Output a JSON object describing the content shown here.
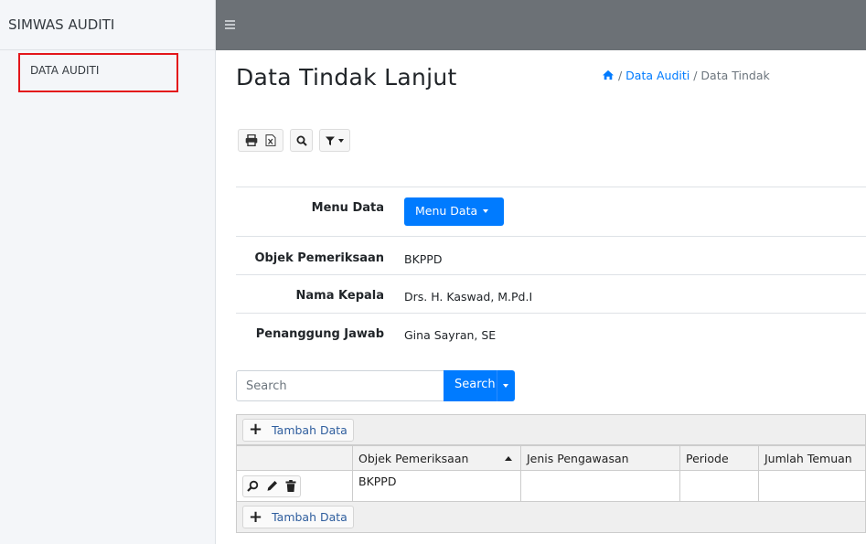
{
  "sidebar": {
    "brand": "SIMWAS AUDITI",
    "items": [
      {
        "label": "DATA AUDITI"
      }
    ]
  },
  "header": {
    "title": "Data Tindak Lanjut",
    "breadcrumb": [
      "Data Auditi",
      "Data Tindak"
    ]
  },
  "toolbar": {
    "icons": [
      "print-icon",
      "excel-icon",
      "search-icon",
      "filter-icon"
    ]
  },
  "details": {
    "menu": {
      "label": "Menu Data",
      "button": "Menu Data"
    },
    "rows": [
      {
        "label": "Objek Pemeriksaan",
        "value": "BKPPD"
      },
      {
        "label": "Nama Kepala",
        "value": "Drs. H. Kaswad, M.Pd.I"
      },
      {
        "label": "Penanggung Jawab",
        "value": "Gina Sayran, SE"
      }
    ]
  },
  "search": {
    "placeholder": "Search",
    "button": "Search"
  },
  "grid": {
    "add_label": "Tambah Data",
    "columns": [
      "",
      "Objek Pemeriksaan",
      "Jenis Pengawasan",
      "Periode",
      "Jumlah Temuan"
    ],
    "rows": [
      {
        "objek": "BKPPD",
        "jenis": "",
        "periode": "",
        "jumlah": ""
      }
    ]
  },
  "colors": {
    "primary": "#007bff",
    "topbar": "#6c7176",
    "highlight": "#e3161b"
  }
}
